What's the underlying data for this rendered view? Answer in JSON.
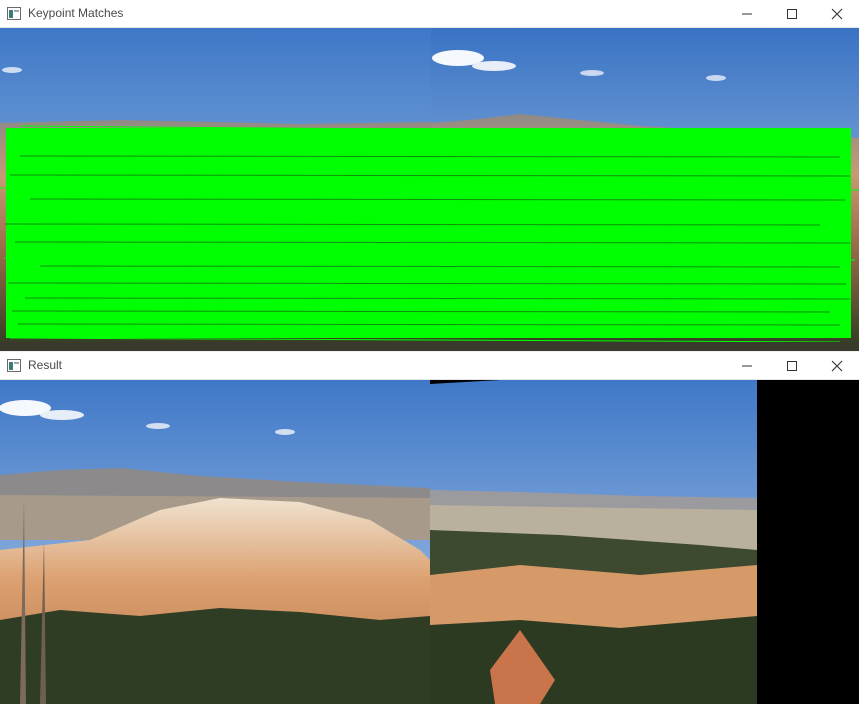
{
  "windows": {
    "matches": {
      "title": "Keypoint Matches",
      "icon": "app-icon",
      "controls": [
        "minimize-icon",
        "maximize-icon",
        "close-icon"
      ],
      "content": "side-by-side landscape photos joined by green keypoint match lines"
    },
    "result": {
      "title": "Result",
      "icon": "app-icon",
      "controls": [
        "minimize-icon",
        "maximize-icon",
        "close-icon"
      ],
      "content": "stitched panorama of canyon landscape"
    }
  },
  "colors": {
    "match_line": "#00ff00",
    "sky_top": "#3f78c8",
    "sky_bottom": "#a9c7e6",
    "rock": "#d9a070",
    "forest": "#2d3b22",
    "background": "#000000"
  }
}
